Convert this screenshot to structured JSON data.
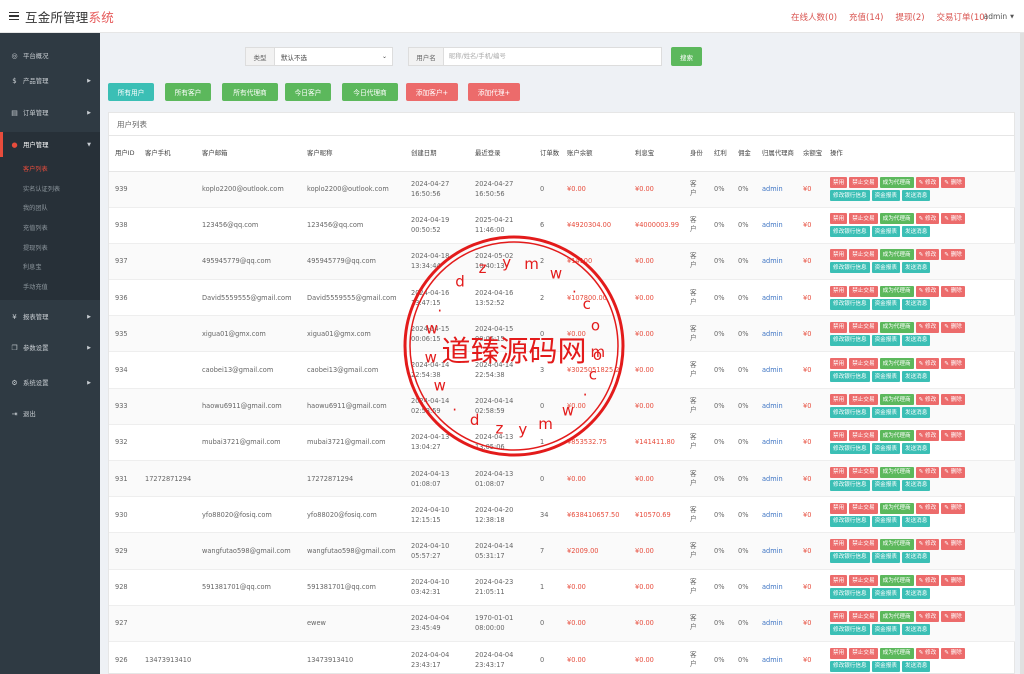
{
  "header": {
    "brand_main": "互金所管理",
    "brand_accent": "系统",
    "links": [
      {
        "label": "在线人数(0)"
      },
      {
        "label": "充值(14)"
      },
      {
        "label": "提现(2)"
      },
      {
        "label": "交易订单(10)"
      }
    ],
    "user": "admin"
  },
  "sidebar": {
    "items": [
      {
        "label": "平台概况",
        "icon": "dashboard-icon"
      },
      {
        "label": "产品管理",
        "icon": "dollar-icon"
      },
      {
        "label": "订单管理",
        "icon": "document-icon"
      },
      {
        "label": "用户管理",
        "icon": "user-icon"
      },
      {
        "label": "报表管理",
        "icon": "yen-icon"
      },
      {
        "label": "参数设置",
        "icon": "copy-icon"
      },
      {
        "label": "系统设置",
        "icon": "gears-icon"
      },
      {
        "label": "退出",
        "icon": "logout-icon"
      }
    ],
    "sub_items": [
      {
        "label": "客户列表"
      },
      {
        "label": "实名认证列表"
      },
      {
        "label": "我的团队"
      },
      {
        "label": "充值列表"
      },
      {
        "label": "提现列表"
      },
      {
        "label": "利息宝"
      },
      {
        "label": "手动充值"
      }
    ]
  },
  "filter": {
    "type_label": "类型",
    "type_value": "默认不选",
    "name_label": "用户名",
    "name_placeholder": "昵称/姓名/手机/编号",
    "search_label": "搜索"
  },
  "tabs": [
    {
      "label": "所有用户"
    },
    {
      "label": "所有客户"
    },
    {
      "label": "所有代理商"
    },
    {
      "label": "今日客户"
    },
    {
      "label": "今日代理商"
    },
    {
      "label": "添加客户+"
    },
    {
      "label": "添加代理+"
    }
  ],
  "panel": {
    "title": "用户列表"
  },
  "table": {
    "headers": [
      "用户ID",
      "客户手机",
      "客户邮箱",
      "客户昵称",
      "创建日期",
      "最近登录",
      "订单数",
      "账户余额",
      "利息宝",
      "身份",
      "红利",
      "佣金",
      "归属代理商",
      "余额宝",
      "操作"
    ],
    "op_labels": [
      "禁用",
      "禁止交易",
      "成为代理商",
      "✎ 修改",
      "✎ 删除",
      "修改银行信息",
      "资金报表",
      "发送消息"
    ],
    "rows": [
      {
        "id": "939",
        "phone": "",
        "email": "koplo2200@outlook.com",
        "nick": "koplo2200@outlook.com",
        "created": "2024-04-27 16:50:56",
        "login": "2024-04-27 16:50:56",
        "orders": "0",
        "balance": "¥0.00",
        "interest": "¥0.00",
        "role": "客户",
        "bonus": "0%",
        "commission": "0%",
        "agent": "admin",
        "yuebao": "¥0"
      },
      {
        "id": "938",
        "phone": "",
        "email": "123456@qq.com",
        "nick": "123456@qq.com",
        "created": "2024-04-19 00:50:52",
        "login": "2025-04-21 11:46:00",
        "orders": "6",
        "balance": "¥4920304.00",
        "interest": "¥4000003.99",
        "role": "客户",
        "bonus": "0%",
        "commission": "0%",
        "agent": "admin",
        "yuebao": "¥0"
      },
      {
        "id": "937",
        "phone": "",
        "email": "495945779@qq.com",
        "nick": "495945779@qq.com",
        "created": "2024-04-18 13:34:44",
        "login": "2024-05-02 10:40:13",
        "orders": "2",
        "balance": "¥14100",
        "interest": "¥0.00",
        "role": "客户",
        "bonus": "0%",
        "commission": "0%",
        "agent": "admin",
        "yuebao": "¥0"
      },
      {
        "id": "936",
        "phone": "",
        "email": "David5559555@gmail.com",
        "nick": "David5559555@gmail.com",
        "created": "2024-04-16 13:47:15",
        "login": "2024-04-16 13:52:52",
        "orders": "2",
        "balance": "¥107800.00",
        "interest": "¥0.00",
        "role": "客户",
        "bonus": "0%",
        "commission": "0%",
        "agent": "admin",
        "yuebao": "¥0"
      },
      {
        "id": "935",
        "phone": "",
        "email": "xigua01@gmx.com",
        "nick": "xigua01@gmx.com",
        "created": "2024-04-15 00:06:15",
        "login": "2024-04-15 00:06:15",
        "orders": "0",
        "balance": "¥0.00",
        "interest": "¥0.00",
        "role": "客户",
        "bonus": "0%",
        "commission": "0%",
        "agent": "admin",
        "yuebao": "¥0"
      },
      {
        "id": "934",
        "phone": "",
        "email": "caobei13@gmail.com",
        "nick": "caobei13@gmail.com",
        "created": "2024-04-14 22:54:38",
        "login": "2024-04-14 22:54:38",
        "orders": "3",
        "balance": "¥3025051825.2",
        "interest": "¥0.00",
        "role": "客户",
        "bonus": "0%",
        "commission": "0%",
        "agent": "admin",
        "yuebao": "¥0"
      },
      {
        "id": "933",
        "phone": "",
        "email": "haowu6911@gmail.com",
        "nick": "haowu6911@gmail.com",
        "created": "2024-04-14 02:58:59",
        "login": "2024-04-14 02:58:59",
        "orders": "0",
        "balance": "¥0.00",
        "interest": "¥0.00",
        "role": "客户",
        "bonus": "0%",
        "commission": "0%",
        "agent": "admin",
        "yuebao": "¥0"
      },
      {
        "id": "932",
        "phone": "",
        "email": "mubai3721@gmail.com",
        "nick": "mubai3721@gmail.com",
        "created": "2024-04-13 13:04:27",
        "login": "2024-04-13 13:05:06",
        "orders": "1",
        "balance": "¥853532.75",
        "interest": "¥141411.80",
        "role": "客户",
        "bonus": "0%",
        "commission": "0%",
        "agent": "admin",
        "yuebao": "¥0"
      },
      {
        "id": "931",
        "phone": "17272871294",
        "email": "",
        "nick": "17272871294",
        "created": "2024-04-13 01:08:07",
        "login": "2024-04-13 01:08:07",
        "orders": "0",
        "balance": "¥0.00",
        "interest": "¥0.00",
        "role": "客户",
        "bonus": "0%",
        "commission": "0%",
        "agent": "admin",
        "yuebao": "¥0"
      },
      {
        "id": "930",
        "phone": "",
        "email": "yfo88020@fosiq.com",
        "nick": "yfo88020@fosiq.com",
        "created": "2024-04-10 12:15:15",
        "login": "2024-04-20 12:38:18",
        "orders": "34",
        "balance": "¥638410657.50",
        "interest": "¥10570.69",
        "role": "客户",
        "bonus": "0%",
        "commission": "0%",
        "agent": "admin",
        "yuebao": "¥0"
      },
      {
        "id": "929",
        "phone": "",
        "email": "wangfutao598@gmail.com",
        "nick": "wangfutao598@gmail.com",
        "created": "2024-04-10 05:57:27",
        "login": "2024-04-14 05:31:17",
        "orders": "7",
        "balance": "¥2009.00",
        "interest": "¥0.00",
        "role": "客户",
        "bonus": "0%",
        "commission": "0%",
        "agent": "admin",
        "yuebao": "¥0"
      },
      {
        "id": "928",
        "phone": "",
        "email": "591381701@qq.com",
        "nick": "591381701@qq.com",
        "created": "2024-04-10 03:42:31",
        "login": "2024-04-23 21:05:11",
        "orders": "1",
        "balance": "¥0.00",
        "interest": "¥0.00",
        "role": "客户",
        "bonus": "0%",
        "commission": "0%",
        "agent": "admin",
        "yuebao": "¥0"
      },
      {
        "id": "927",
        "phone": "",
        "email": "",
        "nick": "ewew",
        "created": "2024-04-04 23:45:49",
        "login": "1970-01-01 08:00:00",
        "orders": "0",
        "balance": "¥0.00",
        "interest": "¥0.00",
        "role": "客户",
        "bonus": "0%",
        "commission": "0%",
        "agent": "admin",
        "yuebao": "¥0"
      },
      {
        "id": "926",
        "phone": "13473913410",
        "email": "",
        "nick": "13473913410",
        "created": "2024-04-04 23:43:17",
        "login": "2024-04-04 23:43:17",
        "orders": "0",
        "balance": "¥0.00",
        "interest": "¥0.00",
        "role": "客户",
        "bonus": "0%",
        "commission": "0%",
        "agent": "admin",
        "yuebao": "¥0"
      }
    ]
  },
  "watermark": {
    "center_text": "道臻源码网",
    "ring_letters": "w.dzym.com",
    "color": "#e31b1b"
  }
}
